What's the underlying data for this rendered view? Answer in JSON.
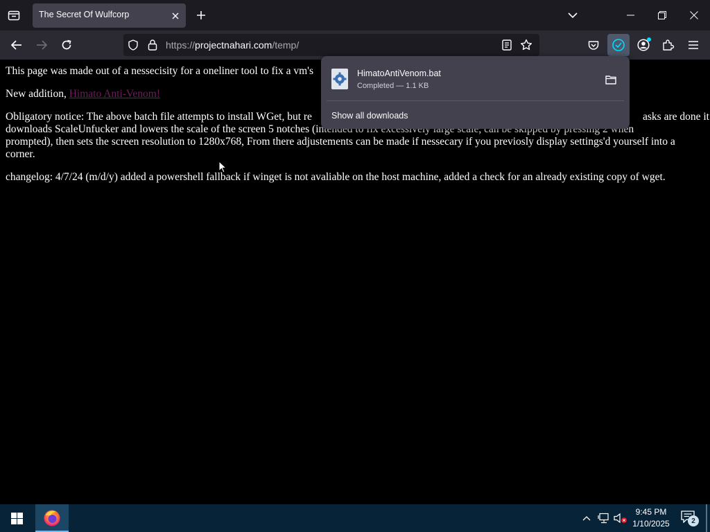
{
  "browser": {
    "tab": {
      "title": "The Secret Of Wulfcorp"
    },
    "url": {
      "scheme": "https://",
      "host": "projectnahari.com",
      "path": "/temp/"
    }
  },
  "page": {
    "line1": "This page was made out of a nessecisity for a oneliner tool to fix a vm's",
    "addition_prefix": "New addition, ",
    "addition_link": "Himato Anti-Venom!",
    "notice_line1_a": "Obligatory notice: The above batch file attempts to install WGet, but re",
    "notice_line1_b": "asks are done it",
    "notice_line2_a": "downloads ScaleUnfucker and lowers the scale of the screen 5 notches (",
    "notice_line2_b": "intended to fix excessively large scale, can be skipped by pressing 2",
    "notice_line2_c": " when",
    "notice_line3": "prompted), then sets the screen resolution to 1280x768, From there adjustements can be made if nessecary if you previosly display settings'd yourself into a",
    "notice_line4": "corner.",
    "changelog": "changelog: 4/7/24 (m/d/y) added a powershell fallback if winget is not avaliable on the host machine, added a check for an already existing copy of wget."
  },
  "downloads_panel": {
    "file_name": "HimatoAntiVenom.bat",
    "status": "Completed — 1.1 KB",
    "show_all": "Show all downloads"
  },
  "taskbar": {
    "time": "9:45 PM",
    "date": "1/10/2025",
    "notification_count": "2"
  },
  "colors": {
    "accent": "#00ddff",
    "link_visited": "#6f1d5e",
    "taskbar": "#072338"
  }
}
